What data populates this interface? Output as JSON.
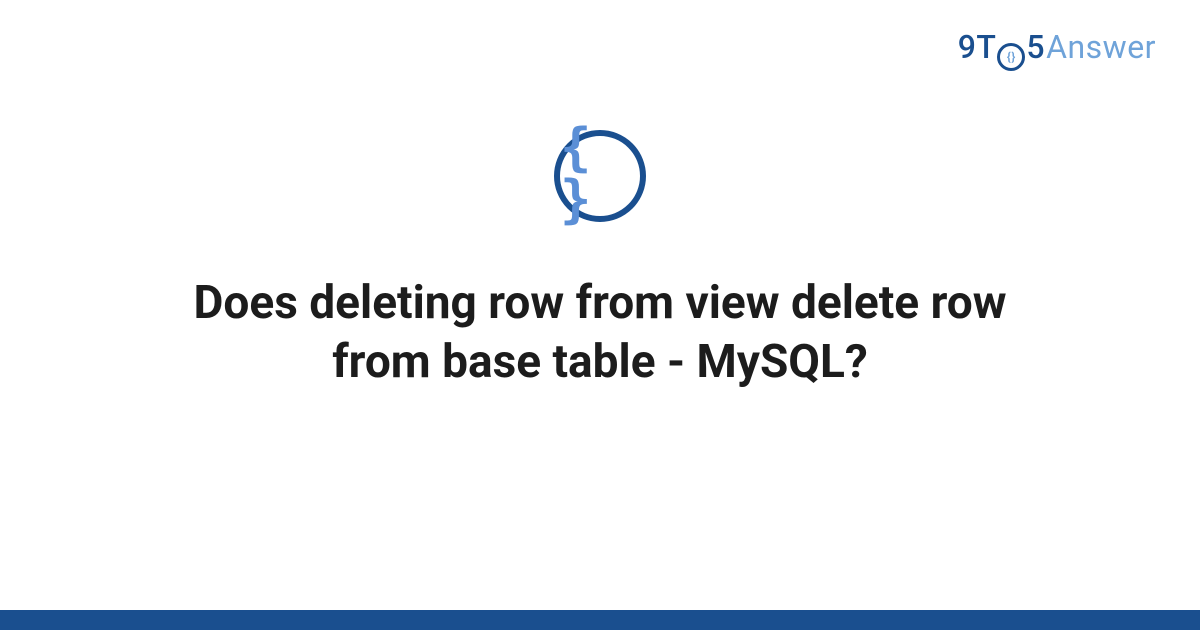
{
  "logo": {
    "part_9t": "9T",
    "part_circle_inner": "{}",
    "part_5": "5",
    "part_answer": "Answer"
  },
  "topic_icon": {
    "glyph": "{ }",
    "name": "code-braces-icon"
  },
  "question": {
    "title": "Does deleting row from view delete row from base table - MySQL?"
  },
  "colors": {
    "brand_dark": "#1a4f8f",
    "brand_light": "#6fa3d9",
    "text": "#1c1c1c",
    "background": "#ffffff"
  }
}
